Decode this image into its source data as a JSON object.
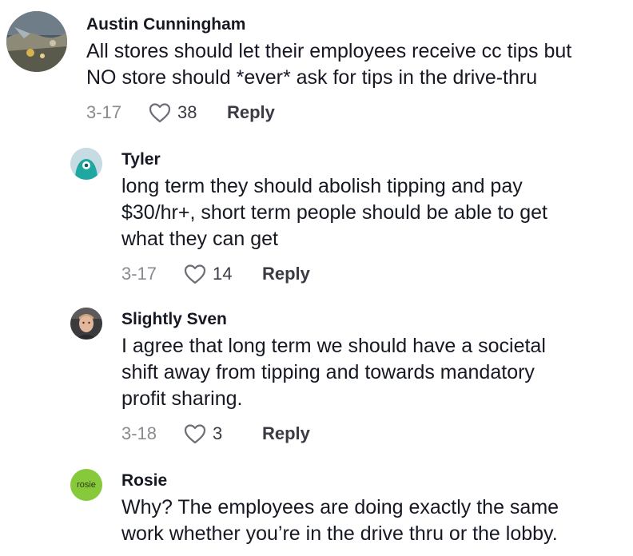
{
  "comments": [
    {
      "author": "Austin Cunningham",
      "text": "All stores should let their employees receive cc tips but\nNO store should *ever* ask for tips in the drive-thru",
      "date": "3-17",
      "likes": "38",
      "reply_label": "Reply",
      "avatar_icon": "photo-avatar"
    },
    {
      "author": "Tyler",
      "text": "long term they should abolish tipping and pay\n$30/hr+, short term people should be able to get\nwhat they can get",
      "date": "3-17",
      "likes": "14",
      "reply_label": "Reply",
      "avatar_icon": "default-avatar"
    },
    {
      "author": "Slightly Sven",
      "text": "I agree that long term we should have a societal\nshift away from tipping and towards mandatory\nprofit sharing.",
      "date": "3-18",
      "likes": "3",
      "reply_label": "Reply",
      "avatar_icon": "photo-avatar"
    },
    {
      "author": "Rosie",
      "text": "Why? The employees are doing exactly the same\nwork whether you’re in the drive thru or the lobby.",
      "avatar_label": "rosie",
      "avatar_icon": "text-avatar"
    }
  ],
  "colors": {
    "text": "#161823",
    "muted": "#8a8b91",
    "rosie_avatar": "#86c93a",
    "tyler_avatar": "#1fa8a2"
  }
}
